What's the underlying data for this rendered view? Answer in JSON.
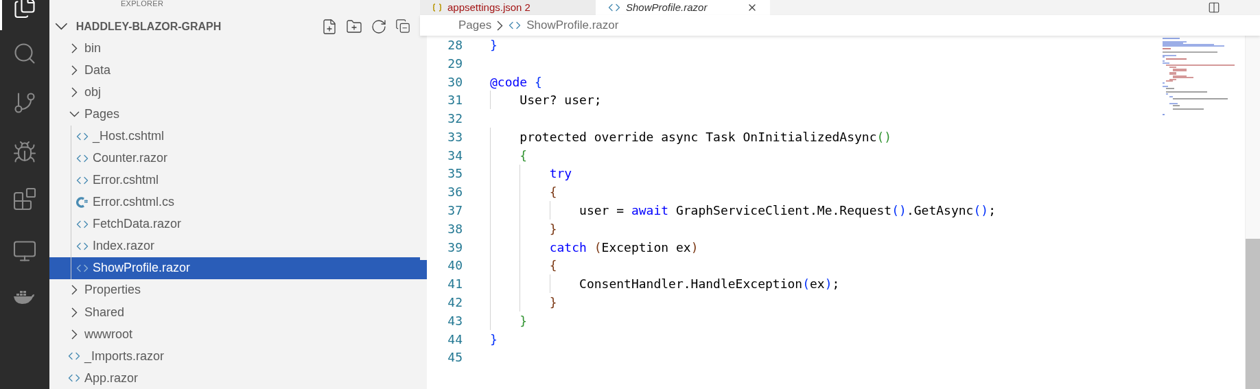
{
  "sidebar": {
    "title": "EXPLORER",
    "root": {
      "label": "HADDLEY-BLAZOR-GRAPH",
      "expanded": true
    },
    "items": [
      {
        "label": "bin",
        "kind": "folder",
        "expanded": false,
        "selected": false
      },
      {
        "label": "Data",
        "kind": "folder",
        "expanded": false,
        "selected": false
      },
      {
        "label": "obj",
        "kind": "folder",
        "expanded": false,
        "selected": false
      },
      {
        "label": "Pages",
        "kind": "folder",
        "expanded": true,
        "selected": false,
        "children": [
          {
            "label": "_Host.cshtml",
            "kind": "razor",
            "selected": false
          },
          {
            "label": "Counter.razor",
            "kind": "razor",
            "selected": false
          },
          {
            "label": "Error.cshtml",
            "kind": "razor",
            "selected": false
          },
          {
            "label": "Error.cshtml.cs",
            "kind": "csharp",
            "selected": false
          },
          {
            "label": "FetchData.razor",
            "kind": "razor",
            "selected": false
          },
          {
            "label": "Index.razor",
            "kind": "razor",
            "selected": false
          },
          {
            "label": "ShowProfile.razor",
            "kind": "razor",
            "selected": true
          }
        ]
      },
      {
        "label": "Properties",
        "kind": "folder",
        "expanded": false,
        "selected": false
      },
      {
        "label": "Shared",
        "kind": "folder",
        "expanded": false,
        "selected": false
      },
      {
        "label": "wwwroot",
        "kind": "folder",
        "expanded": false,
        "selected": false
      },
      {
        "label": "_Imports.razor",
        "kind": "razor",
        "selected": false
      },
      {
        "label": "App.razor",
        "kind": "razor",
        "selected": false
      }
    ]
  },
  "tabs": [
    {
      "label": "appsettings.json 2",
      "kind": "json",
      "selected": false
    },
    {
      "label": "ShowProfile.razor",
      "kind": "razor",
      "selected": true
    }
  ],
  "breadcrumb": [
    {
      "label": "Pages",
      "kind": "folder"
    },
    {
      "label": "ShowProfile.razor",
      "kind": "razor"
    }
  ],
  "editor": {
    "lines": [
      {
        "number": "28",
        "tokens": [
          {
            "text": "}",
            "kind": "bracket1"
          }
        ]
      },
      {
        "number": "29"
      },
      {
        "number": "30",
        "tokens": [
          {
            "text": "@code",
            "kind": "keyword"
          },
          {
            "text": " {",
            "kind": "bracket1"
          }
        ]
      },
      {
        "number": "31",
        "tokens": [
          {
            "text": "    User? user;",
            "kind": "plain"
          }
        ]
      },
      {
        "number": "32"
      },
      {
        "number": "33",
        "tokens": [
          {
            "text": "    protected override async Task OnInitializedAsync",
            "kind": "plain"
          },
          {
            "text": "()",
            "kind": "bracket2"
          }
        ]
      },
      {
        "number": "34",
        "tokens": [
          {
            "text": "    {",
            "kind": "bracket2"
          }
        ]
      },
      {
        "number": "35",
        "tokens": [
          {
            "text": "        try",
            "kind": "keyword"
          }
        ]
      },
      {
        "number": "36",
        "tokens": [
          {
            "text": "        {",
            "kind": "bracket3"
          }
        ]
      },
      {
        "number": "37",
        "tokens": [
          {
            "text": "            user = ",
            "kind": "plain"
          },
          {
            "text": "await",
            "kind": "keyword"
          },
          {
            "text": " GraphServiceClient.Me.Request",
            "kind": "plain"
          },
          {
            "text": "()",
            "kind": "bracket1"
          },
          {
            "text": ".GetAsync",
            "kind": "plain"
          },
          {
            "text": "()",
            "kind": "bracket1"
          },
          {
            "text": ";",
            "kind": "plain"
          }
        ]
      },
      {
        "number": "38",
        "tokens": [
          {
            "text": "        }",
            "kind": "bracket3"
          }
        ]
      },
      {
        "number": "39",
        "tokens": [
          {
            "text": "        catch",
            "kind": "keyword"
          },
          {
            "text": " (",
            "kind": "bracket3"
          },
          {
            "text": "Exception ex",
            "kind": "plain"
          },
          {
            "text": ")",
            "kind": "bracket3"
          }
        ]
      },
      {
        "number": "40",
        "tokens": [
          {
            "text": "        {",
            "kind": "bracket3"
          }
        ]
      },
      {
        "number": "41",
        "tokens": [
          {
            "text": "            ConsentHandler.HandleException",
            "kind": "plain"
          },
          {
            "text": "(",
            "kind": "bracket1"
          },
          {
            "text": "ex",
            "kind": "plain"
          },
          {
            "text": ")",
            "kind": "bracket1"
          },
          {
            "text": ";",
            "kind": "plain"
          }
        ]
      },
      {
        "number": "42",
        "tokens": [
          {
            "text": "        }",
            "kind": "bracket3"
          }
        ]
      },
      {
        "number": "43",
        "tokens": [
          {
            "text": "    }",
            "kind": "bracket2"
          }
        ]
      },
      {
        "number": "44",
        "tokens": [
          {
            "text": "}",
            "kind": "bracket1"
          }
        ]
      },
      {
        "number": "45"
      }
    ]
  }
}
